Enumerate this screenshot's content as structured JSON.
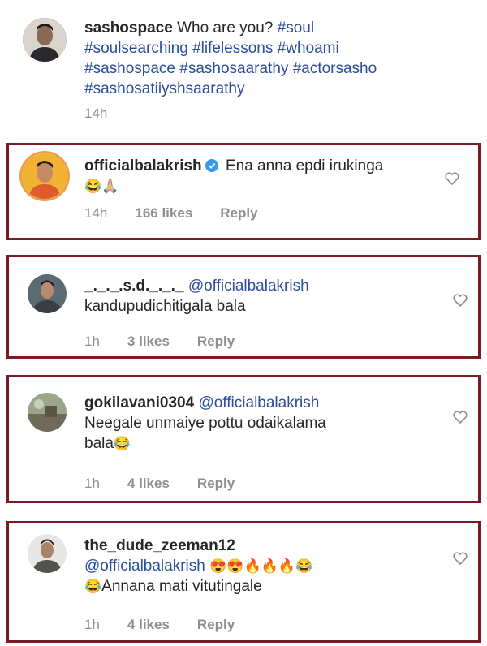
{
  "caption": {
    "username": "sashospace",
    "text": "Who are you?",
    "hashtags": [
      "#soul",
      "#soulsearching",
      "#lifelessons",
      "#whoami",
      "#sashospace",
      "#sashosaarathy",
      "#actorsasho",
      "#sashosatiiyshsaarathy"
    ],
    "time": "14h"
  },
  "comments": [
    {
      "username": "officialbalakrish",
      "verified": true,
      "text": "Ena anna epdi irukinga",
      "emoji": "😂🙏🏼",
      "time": "14h",
      "likes": "166 likes",
      "reply": "Reply"
    },
    {
      "username": "_._._.s.d._._._",
      "mention": "@officialbalakrish",
      "text": "kandupudichitigala bala",
      "time": "1h",
      "likes": "3 likes",
      "reply": "Reply"
    },
    {
      "username": "gokilavani0304",
      "mention": "@officialbalakrish",
      "text_line1": "Neegale unmaiye pottu odaikalama",
      "text_line2": "bala",
      "emoji": "😂",
      "time": "1h",
      "likes": "4 likes",
      "reply": "Reply"
    },
    {
      "username": "the_dude_zeeman12",
      "mention": "@officialbalakrish",
      "emoji_line1": "😍😍🔥🔥🔥😂",
      "emoji_line2": "😂",
      "text": "Annana mati vitutingale",
      "time": "1h",
      "likes": "4 likes",
      "reply": "Reply"
    }
  ],
  "colors": {
    "frame": "#7a1a25",
    "link": "#2b4e9a",
    "muted": "#8e8e8e",
    "verified": "#3897f0"
  },
  "icons": [
    "heart-outline-icon",
    "verified-badge-icon"
  ]
}
